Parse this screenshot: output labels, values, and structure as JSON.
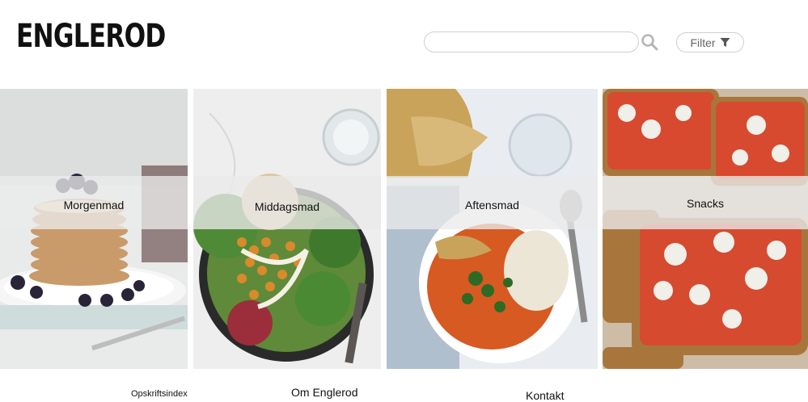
{
  "header": {
    "logo": "ENGLEROD",
    "search": {
      "value": "",
      "placeholder": ""
    },
    "filter_label": "Filter"
  },
  "categories": [
    {
      "label": "Morgenmad"
    },
    {
      "label": "Middagsmad"
    },
    {
      "label": "Aftensmad"
    },
    {
      "label": "Snacks"
    }
  ],
  "footer": {
    "links": [
      "Opskriftsindex",
      "Om Englerod",
      "Kontakt"
    ]
  },
  "icons": {
    "search": "search-icon",
    "filter": "filter-funnel-icon"
  },
  "colors": {
    "text": "#111111",
    "border": "#cfcfcf",
    "icon_gray": "#b5b5b5",
    "band": "#ebebeb"
  }
}
